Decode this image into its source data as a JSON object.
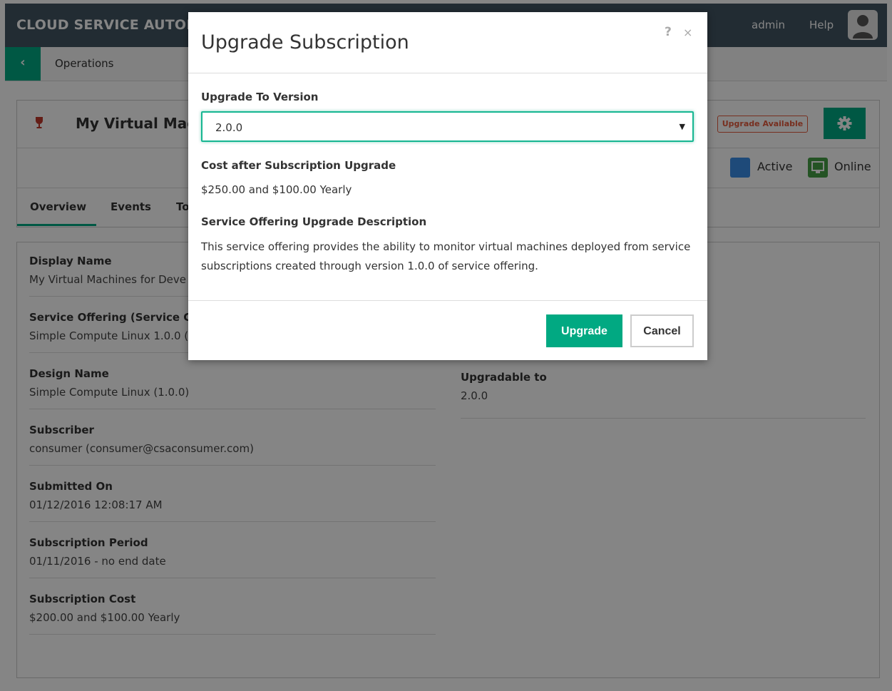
{
  "header": {
    "app_title": "CLOUD SERVICE AUTOM",
    "user": "admin",
    "help": "Help"
  },
  "breadcrumb": {
    "back_glyph": "‹",
    "label": "Operations"
  },
  "subscription": {
    "title": "My Virtual Mach",
    "badge": "Upgrade Available",
    "status_active": "Active",
    "status_online": "Online",
    "tabs": [
      "Overview",
      "Events",
      "To"
    ]
  },
  "details": {
    "left": [
      {
        "label": "Display Name",
        "value": "My Virtual Machines for Deve"
      },
      {
        "label": "Service Offering (Service Ca",
        "value": "Simple Compute Linux 1.0.0 ("
      },
      {
        "label": "Design Name",
        "value": "Simple Compute Linux (1.0.0)"
      },
      {
        "label": "Subscriber",
        "value": "consumer (consumer@csaconsumer.com)"
      },
      {
        "label": "Submitted On",
        "value": "01/12/2016 12:08:17 AM"
      },
      {
        "label": "Subscription Period",
        "value": "01/11/2016 - no end date"
      },
      {
        "label": "Subscription Cost",
        "value": "$200.00 and $100.00 Yearly"
      }
    ],
    "right": [
      {
        "label": "Upgradable to",
        "value": "2.0.0"
      }
    ]
  },
  "modal": {
    "title": "Upgrade Subscription",
    "help_glyph": "?",
    "close_glyph": "×",
    "version_label": "Upgrade To Version",
    "selected_version": "2.0.0",
    "cost_label": "Cost after Subscription Upgrade",
    "cost_value": "$250.00 and $100.00 Yearly",
    "desc_label": "Service Offering Upgrade Description",
    "desc_text": "This service offering provides the ability to monitor virtual machines deployed from service subscriptions created through version 1.0.0 of service offering.",
    "upgrade_label": "Upgrade",
    "cancel_label": "Cancel"
  },
  "icons": {
    "back": "chevron-left-icon",
    "trophy": "trophy-icon",
    "gear": "gear-icon",
    "active": "globe-icon",
    "online": "monitor-icon",
    "avatar": "user-avatar-icon",
    "help": "help-icon",
    "close": "close-icon",
    "select": "chevron-down-icon"
  },
  "colors": {
    "brand_green": "#01a982",
    "header_bg": "#425563",
    "badge_red": "#e55a3c"
  }
}
